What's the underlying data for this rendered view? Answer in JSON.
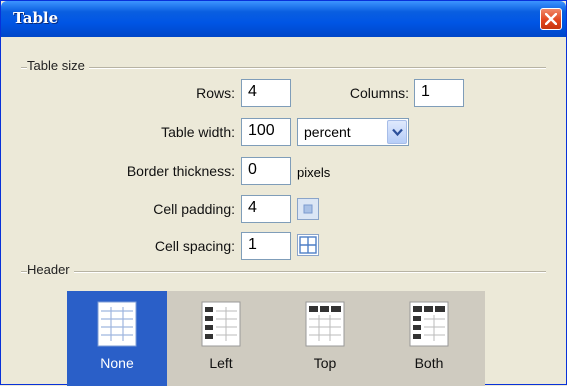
{
  "window": {
    "title": "Table"
  },
  "table_size": {
    "group_label": "Table size",
    "rows_label": "Rows:",
    "rows_value": "4",
    "columns_label": "Columns:",
    "columns_value": "1",
    "width_label": "Table width:",
    "width_value": "100",
    "width_unit_selected": "percent",
    "border_label": "Border thickness:",
    "border_value": "0",
    "border_unit": "pixels",
    "padding_label": "Cell padding:",
    "padding_value": "4",
    "spacing_label": "Cell spacing:",
    "spacing_value": "1"
  },
  "header": {
    "group_label": "Header",
    "options": [
      {
        "label": "None",
        "selected": true
      },
      {
        "label": "Left",
        "selected": false
      },
      {
        "label": "Top",
        "selected": false
      },
      {
        "label": "Both",
        "selected": false
      }
    ]
  },
  "colors": {
    "titlebar": "#0055e5",
    "close": "#e2461f",
    "selection": "#2a5fc8",
    "dialog_bg": "#ece9d8"
  },
  "icons": [
    "close-icon",
    "dropdown-arrow-icon",
    "cell-padding-icon",
    "cell-spacing-icon",
    "header-none-icon",
    "header-left-icon",
    "header-top-icon",
    "header-both-icon"
  ]
}
